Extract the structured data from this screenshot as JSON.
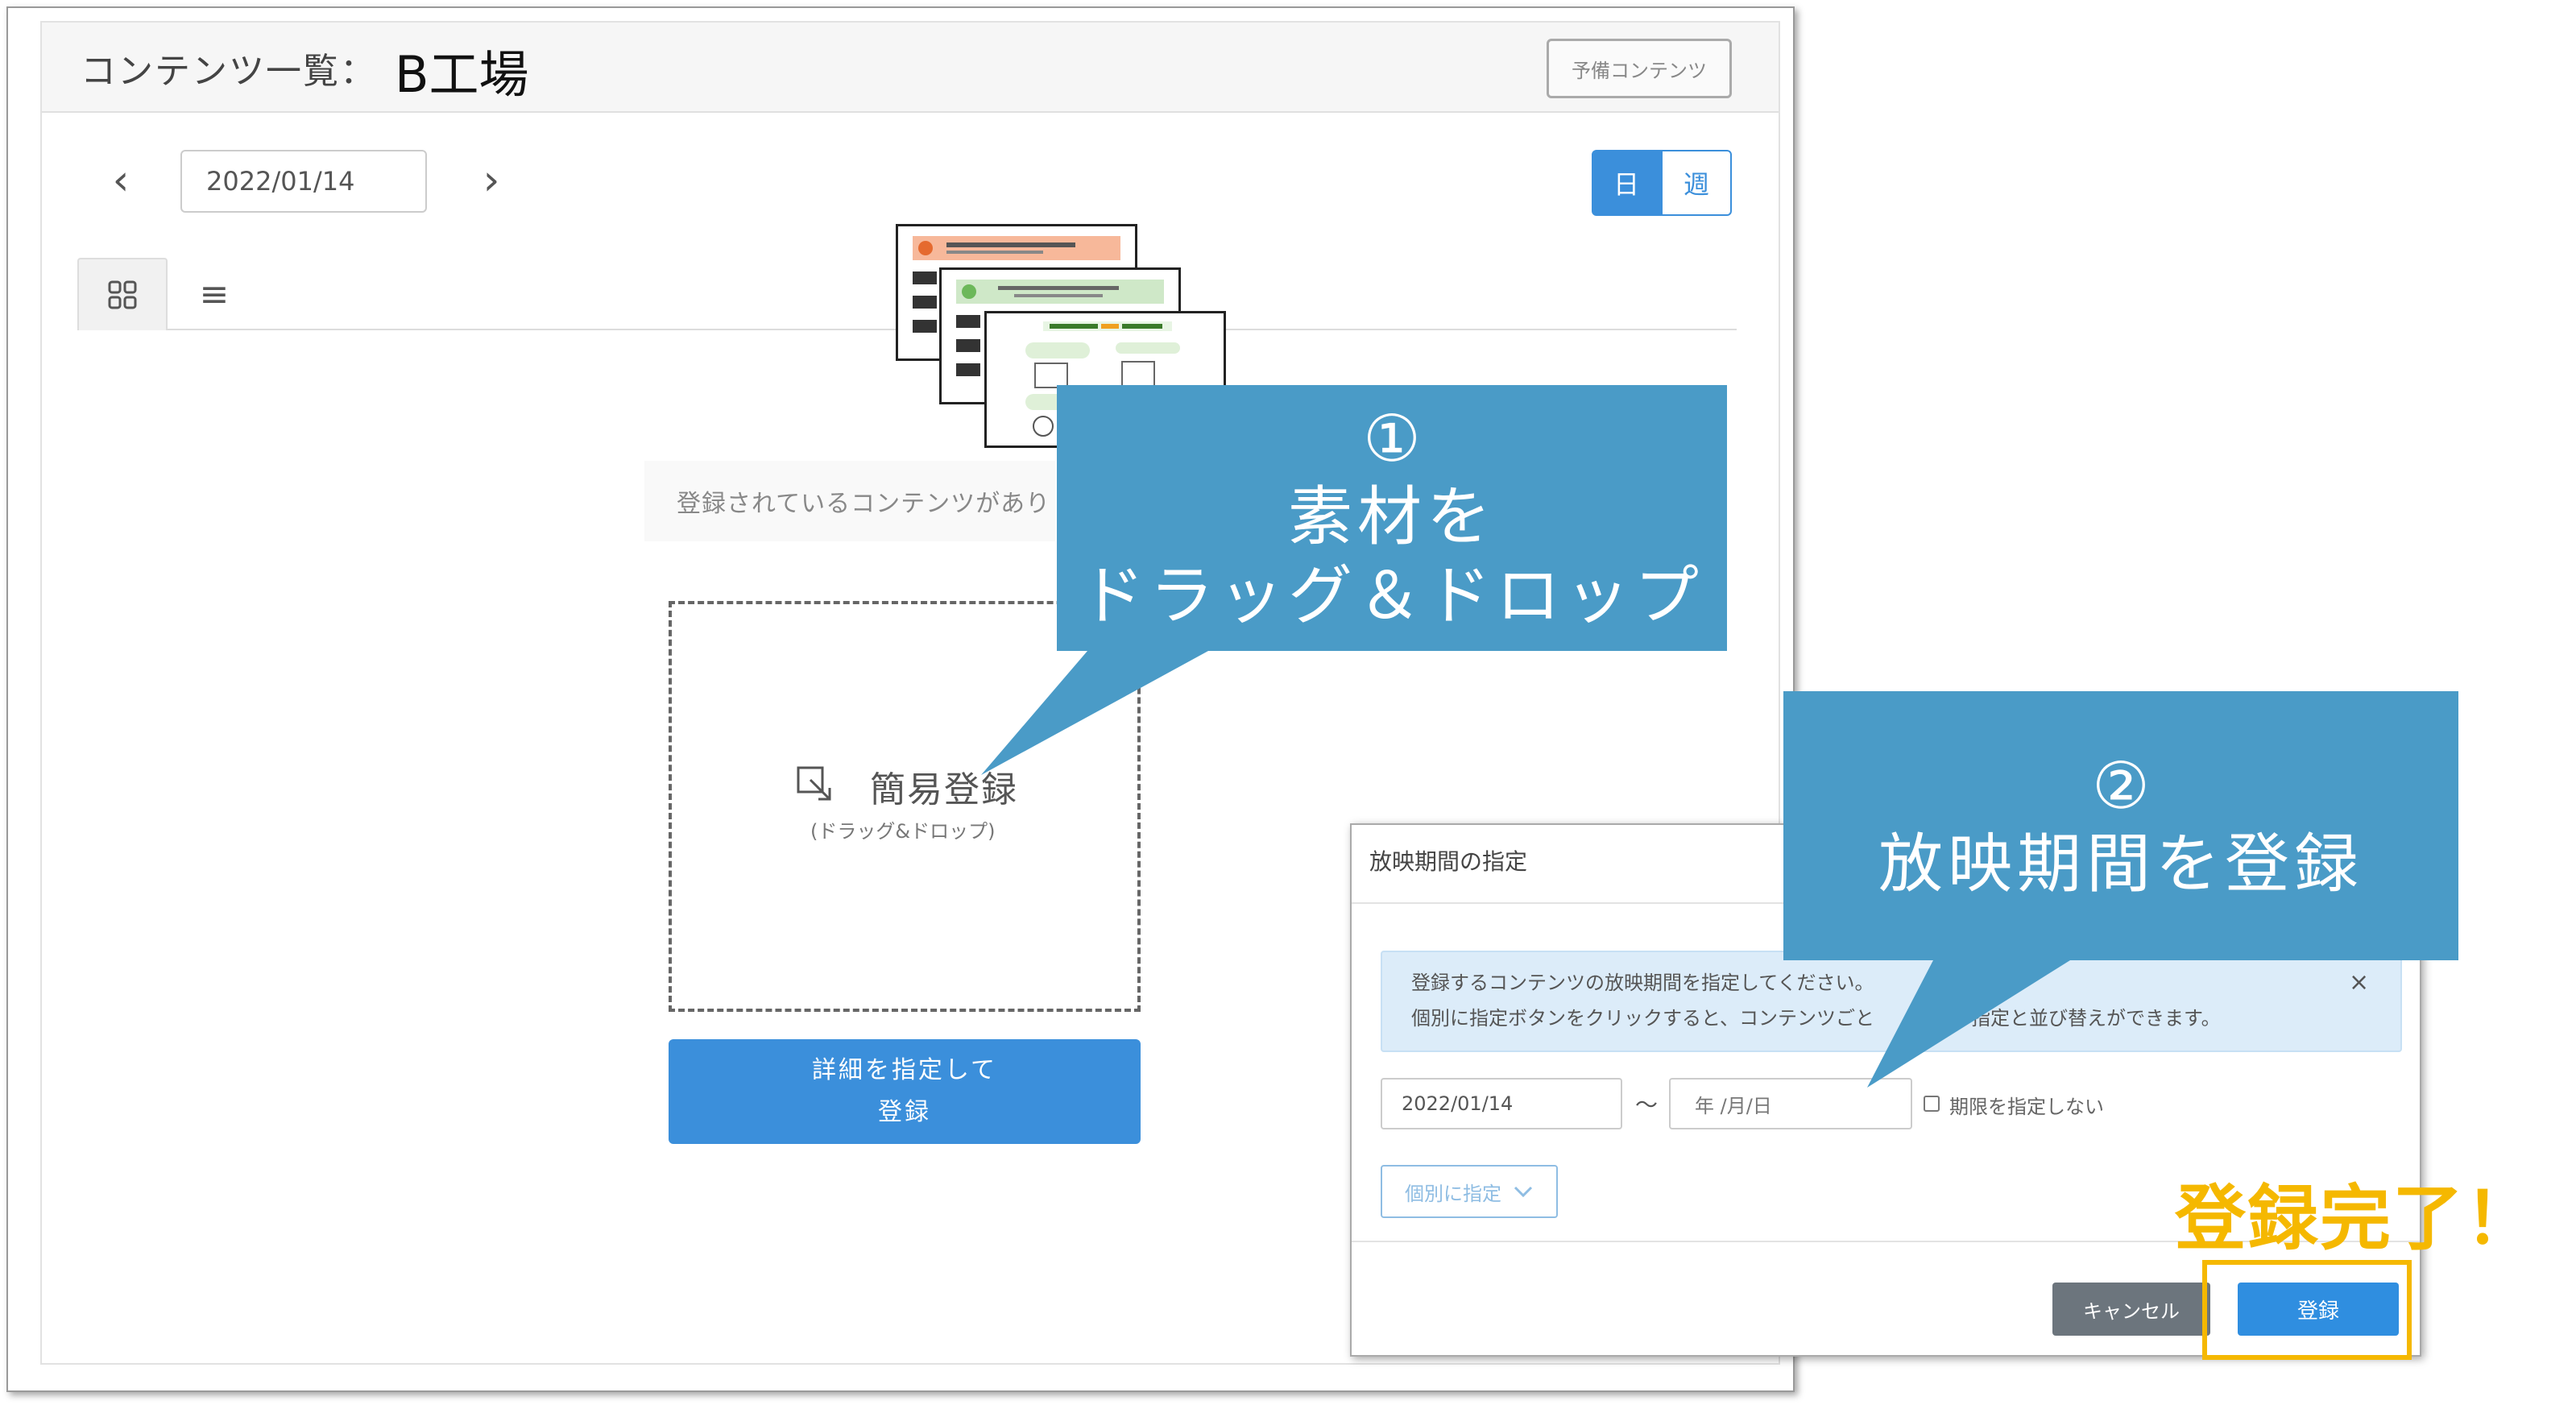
{
  "header": {
    "title_prefix": "コンテンツ一覧：",
    "title_name": "B工場",
    "reserve_button": "予備コンテンツ"
  },
  "toolbar": {
    "prev_icon": "chevron-left",
    "next_icon": "chevron-right",
    "date": "2022/01/14",
    "view_day": "日",
    "view_week": "週",
    "grid_icon": "grid-icon",
    "list_icon": "list-icon"
  },
  "empty_message": "登録されているコンテンツがあり",
  "dropzone": {
    "label": "簡易登録",
    "sub_label": "(ドラッグ&ドロップ)"
  },
  "detail_button": {
    "line1": "詳細を指定して",
    "line2": "登録"
  },
  "callout1": {
    "number": "①",
    "line1": "素材を",
    "line2": "ドラッグ＆ドロップ"
  },
  "callout2": {
    "number": "②",
    "line1": "放映期間を登録"
  },
  "dialog": {
    "title": "放映期間の指定",
    "info_line1": "登録するコンテンツの放映期間を指定してください。",
    "info_line2": "個別に指定ボタンをクリックすると、コンテンツごと　　期間の指定と並び替えができます。",
    "close_icon": "×",
    "start_date": "2022/01/14",
    "tilde": "～",
    "end_placeholder": "年 /月/日",
    "no_limit_label": "期限を指定しない",
    "individual_button": "個別に指定",
    "cancel_button": "キャンセル",
    "register_button": "登録"
  },
  "done_message": "登録完了！",
  "colors": {
    "primary": "#3b8fdb",
    "callout": "#4a9bc7",
    "highlight": "#f5b800"
  }
}
